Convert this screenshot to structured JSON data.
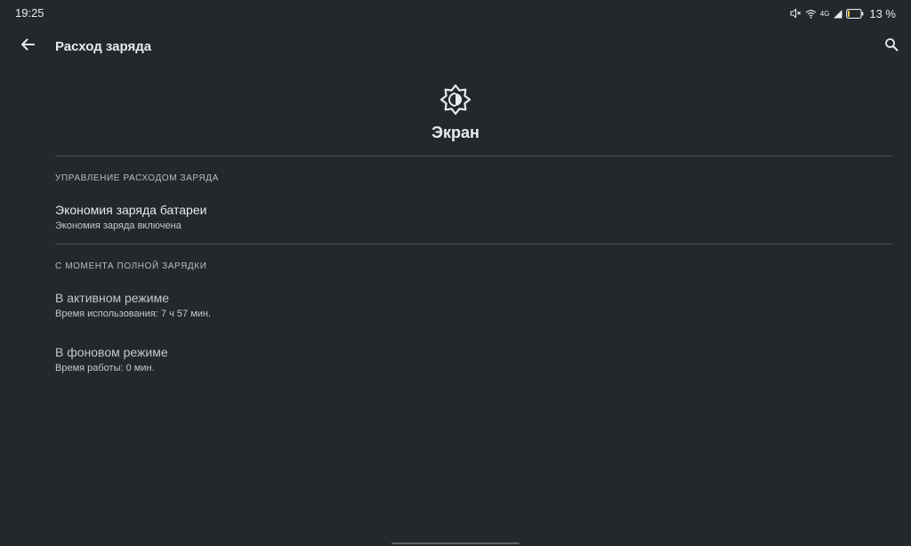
{
  "status_bar": {
    "time": "19:25",
    "network_type": "4G",
    "battery_percent": "13 %",
    "battery_level": 0.13,
    "icons": [
      "mute-icon",
      "wifi-icon",
      "signal-icon",
      "battery-icon"
    ]
  },
  "app_bar": {
    "title": "Расход заряда",
    "back_icon": "arrow-back-icon",
    "search_icon": "search-icon"
  },
  "header": {
    "icon": "brightness-icon",
    "title": "Экран"
  },
  "sections": {
    "management": {
      "header": "Управление расходом заряда",
      "items": [
        {
          "title": "Экономия заряда батареи",
          "summary": "Экономия заряда включена"
        }
      ]
    },
    "since_full_charge": {
      "header": "С момента полной зарядки",
      "items": [
        {
          "title": "В активном режиме",
          "summary": "Время использования: 7 ч 57 мин."
        },
        {
          "title": "В фоновом режиме",
          "summary": "Время работы: 0 мин."
        }
      ]
    }
  },
  "colors": {
    "background": "#24272b",
    "text_primary": "#e8eaed",
    "text_secondary": "#c4c7cc",
    "divider": "#4a4d52"
  }
}
